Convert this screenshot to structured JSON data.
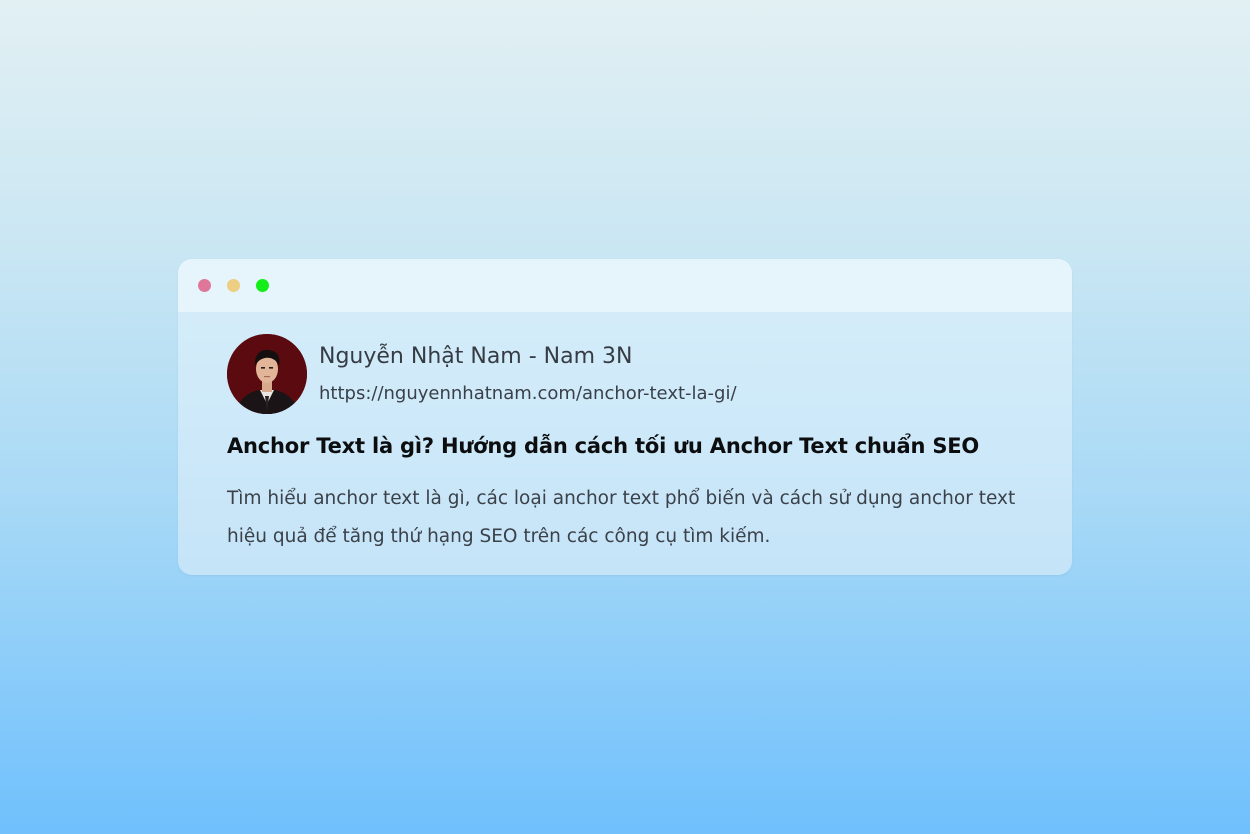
{
  "window": {
    "controls": [
      "close",
      "minimize",
      "maximize"
    ],
    "colors": {
      "close": "#df7898",
      "minimize": "#eccf83",
      "maximize": "#13ee19"
    }
  },
  "result": {
    "site_name": "Nguyễn Nhật Nam - Nam 3N",
    "url": "https://nguyennhatnam.com/anchor-text-la-gi/",
    "title": "Anchor Text là gì? Hướng dẫn cách tối ưu Anchor Text chuẩn SEO",
    "description": "Tìm hiểu anchor text là gì, các loại anchor text phổ biến và cách sử dụng anchor text hiệu quả để tăng thứ hạng SEO trên các công cụ tìm kiếm.",
    "avatar_icon": "author-avatar"
  }
}
